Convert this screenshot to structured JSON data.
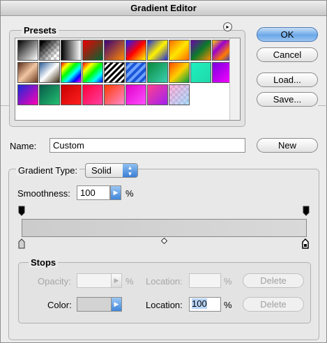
{
  "window": {
    "title": "Gradient Editor"
  },
  "presets": {
    "label": "Presets",
    "menu_icon": "circle-arrow-menu-icon",
    "swatches": [
      {
        "name": "foreground-to-background",
        "bg": "linear-gradient(135deg,#000,#fff)"
      },
      {
        "name": "foreground-to-transparent",
        "bg": "linear-gradient(135deg,#000 10%,rgba(0,0,0,0) 80%),repeating-conic-gradient(#ccc 0 25%,#fff 0 50%) 0 0/8px 8px"
      },
      {
        "name": "black-white",
        "bg": "linear-gradient(90deg,#000,#fff)"
      },
      {
        "name": "red-green",
        "bg": "linear-gradient(135deg,#e00,#063)"
      },
      {
        "name": "violet-orange",
        "bg": "linear-gradient(135deg,#3a007a,#ff8a00)"
      },
      {
        "name": "blue-red-yellow",
        "bg": "linear-gradient(135deg,#1a1aff,#f00,#ff0)"
      },
      {
        "name": "blue-yellow-blue",
        "bg": "linear-gradient(135deg,#1e2cd8,#fff200,#1e2cd8)"
      },
      {
        "name": "orange-yellow-orange",
        "bg": "linear-gradient(135deg,#ff6a00,#ffe600,#ff6a00)"
      },
      {
        "name": "violet-green-orange",
        "bg": "linear-gradient(135deg,#6a00a8,#0a7a2c,#ff8c00)"
      },
      {
        "name": "yellow-violet-orange-blue",
        "bg": "linear-gradient(135deg,#ffd500,#9a00d0,#ff7a00,#1f3ddc)"
      },
      {
        "name": "copper",
        "bg": "linear-gradient(135deg,#5a2b17,#f2c6a2,#6a3a20)"
      },
      {
        "name": "chrome",
        "bg": "linear-gradient(135deg,#2c5d9a,#fff 50%,#3a2a10)"
      },
      {
        "name": "spectrum",
        "bg": "linear-gradient(135deg,#f00,#ff0,#0f0,#0ff,#00f,#f0f)"
      },
      {
        "name": "transparent-rainbow",
        "bg": "linear-gradient(135deg,#f00,#ff0,#0f0,#0ff,#00f)"
      },
      {
        "name": "transparent-stripes",
        "bg": "repeating-linear-gradient(135deg,#000 0 3px,#fff 3px 6px)"
      },
      {
        "name": "blue-stripes",
        "bg": "repeating-linear-gradient(135deg,#1a56d6 0 4px,#6fa3ff 4px 8px)"
      },
      {
        "name": "green-teal",
        "bg": "linear-gradient(135deg,#0a8a3c,#3ad0b0)"
      },
      {
        "name": "orange-red-green",
        "bg": "linear-gradient(135deg,#ff4a00,#ffd000,#00a040)"
      },
      {
        "name": "aqua",
        "bg": "linear-gradient(135deg,#1ef0c0,#20d8a8)"
      },
      {
        "name": "violet-magenta",
        "bg": "linear-gradient(135deg,#7a00e0,#ff00ff)"
      },
      {
        "name": "blue-magenta",
        "bg": "linear-gradient(135deg,#1a2ad8,#ff00b4)"
      },
      {
        "name": "teal-green",
        "bg": "linear-gradient(135deg,#0a5a4a,#22c070)"
      },
      {
        "name": "red",
        "bg": "linear-gradient(135deg,#c80000,#ff2020)"
      },
      {
        "name": "red-magenta",
        "bg": "linear-gradient(135deg,#ff003c,#ff40a0)"
      },
      {
        "name": "orange-pink",
        "bg": "linear-gradient(135deg,#ff3a00,#ff8ad0)"
      },
      {
        "name": "magenta",
        "bg": "linear-gradient(135deg,#e000c8,#ff50ff)"
      },
      {
        "name": "pink-violet",
        "bg": "linear-gradient(135deg,#ff4090,#a020f0)"
      },
      {
        "name": "checker-transparent",
        "bg": "linear-gradient(135deg,rgba(255,128,200,0.6),rgba(120,200,255,0.6)),repeating-conic-gradient(#ccc 0 25%,#fff 0 50%) 0 0/8px 8px"
      }
    ]
  },
  "buttons": {
    "ok": "OK",
    "cancel": "Cancel",
    "load": "Load...",
    "save": "Save...",
    "new": "New"
  },
  "name_row": {
    "label": "Name:",
    "value": "Custom"
  },
  "gradient_type": {
    "label": "Gradient Type:",
    "selected": "Solid"
  },
  "smoothness": {
    "label": "Smoothness:",
    "value": "100",
    "unit": "%"
  },
  "gradient": {
    "left_color": "#cccccc",
    "right_color": "#d9d9d9"
  },
  "stops": {
    "label": "Stops",
    "opacity_label": "Opacity:",
    "opacity_value": "",
    "opacity_unit": "%",
    "opacity_location_label": "Location:",
    "opacity_location_value": "",
    "opacity_location_unit": "%",
    "opacity_delete": "Delete",
    "color_label": "Color:",
    "color_location_label": "Location:",
    "color_location_value": "100",
    "color_location_unit": "%",
    "color_delete": "Delete"
  }
}
